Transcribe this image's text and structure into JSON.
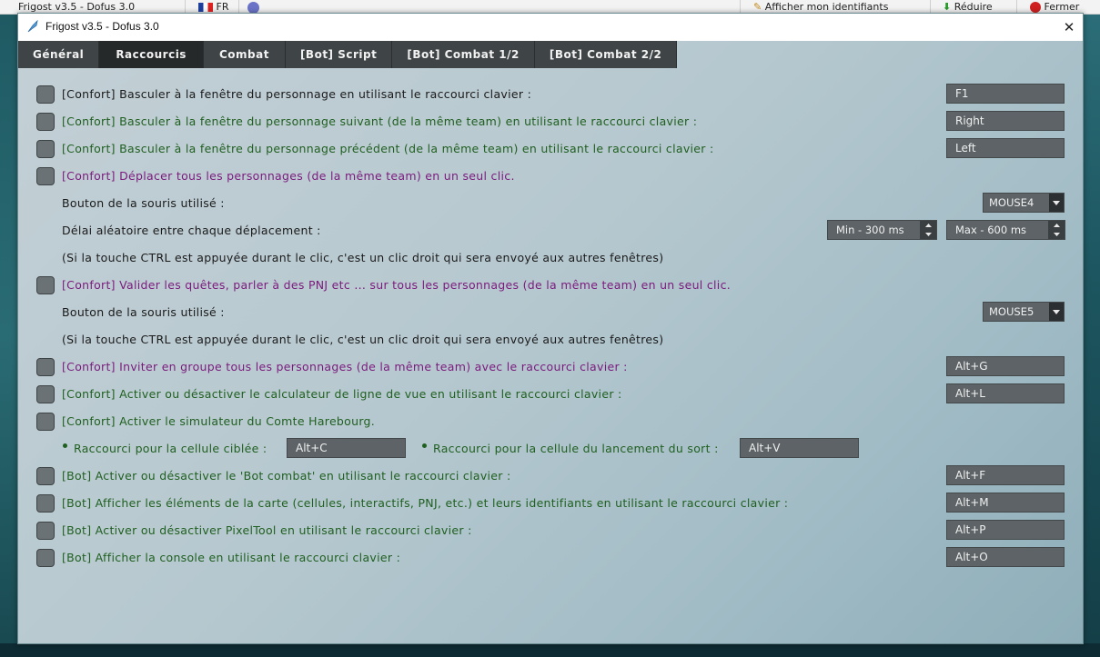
{
  "background": {
    "taskbar_items": [
      {
        "label": "Frigost v3.5 - Dofus 3.0"
      },
      {
        "label": "FR"
      },
      {
        "label": ""
      },
      {
        "label": "Afficher mon identifiants"
      },
      {
        "label": "Réduire"
      },
      {
        "label": "Fermer"
      }
    ]
  },
  "window": {
    "title": "Frigost v3.5 - Dofus 3.0",
    "close_glyph": "✕"
  },
  "tabs": [
    {
      "label": "Général",
      "active": false
    },
    {
      "label": "Raccourcis",
      "active": true
    },
    {
      "label": "Combat",
      "active": false
    },
    {
      "label": "[Bot] Script",
      "active": false
    },
    {
      "label": "[Bot] Combat 1/2",
      "active": false
    },
    {
      "label": "[Bot] Combat 2/2",
      "active": false
    }
  ],
  "rows": {
    "r1": {
      "label": "[Confort] Basculer à la fenêtre du personnage en utilisant le raccourci clavier :",
      "value": "F1"
    },
    "r2": {
      "label": "[Confort] Basculer à la fenêtre du personnage suivant (de la même team) en utilisant le raccourci clavier :",
      "value": "Right"
    },
    "r3": {
      "label": "[Confort] Basculer à la fenêtre du personnage précédent (de la même team) en utilisant le raccourci clavier :",
      "value": "Left"
    },
    "r4": {
      "label": "[Confort] Déplacer tous les personnages (de la même team) en un seul clic."
    },
    "r4_mouse": {
      "label": "Bouton de la souris utilisé :",
      "value": "MOUSE4"
    },
    "r4_delay": {
      "label": "Délai aléatoire entre chaque déplacement :",
      "min": "Min - 300 ms",
      "max": "Max - 600 ms"
    },
    "r4_note": {
      "label": "(Si la touche CTRL est appuyée durant le clic, c'est un clic droit qui sera envoyé aux autres fenêtres)"
    },
    "r5": {
      "label": "[Confort] Valider les quêtes, parler à des PNJ etc ... sur tous les personnages (de la même team) en un seul clic."
    },
    "r5_mouse": {
      "label": "Bouton de la souris utilisé :",
      "value": "MOUSE5"
    },
    "r5_note": {
      "label": "(Si la touche CTRL est appuyée durant le clic, c'est un clic droit qui sera envoyé aux autres fenêtres)"
    },
    "r6": {
      "label": "[Confort] Inviter en groupe tous les personnages (de la même team) avec le raccourci clavier :",
      "value": "Alt+G"
    },
    "r7": {
      "label": "[Confort] Activer ou désactiver le calculateur de ligne de vue en utilisant le raccourci clavier :",
      "value": "Alt+L"
    },
    "r8": {
      "label": "[Confort] Activer le simulateur du Comte Harebourg."
    },
    "r8_sub": {
      "label1": "Raccourci pour la cellule ciblée :",
      "value1": "Alt+C",
      "label2": "Raccourci pour la cellule du lancement du sort :",
      "value2": "Alt+V"
    },
    "r9": {
      "label": "[Bot] Activer ou désactiver le 'Bot combat' en utilisant le raccourci clavier :",
      "value": "Alt+F"
    },
    "r10": {
      "label": "[Bot] Afficher les éléments de la carte (cellules, interactifs, PNJ, etc.) et leurs identifiants en utilisant le raccourci clavier :",
      "value": "Alt+M"
    },
    "r11": {
      "label": "[Bot] Activer ou désactiver PixelTool en utilisant le raccourci clavier :",
      "value": "Alt+P"
    },
    "r12": {
      "label": "[Bot] Afficher la console en utilisant le raccourci clavier :",
      "value": "Alt+O"
    }
  }
}
